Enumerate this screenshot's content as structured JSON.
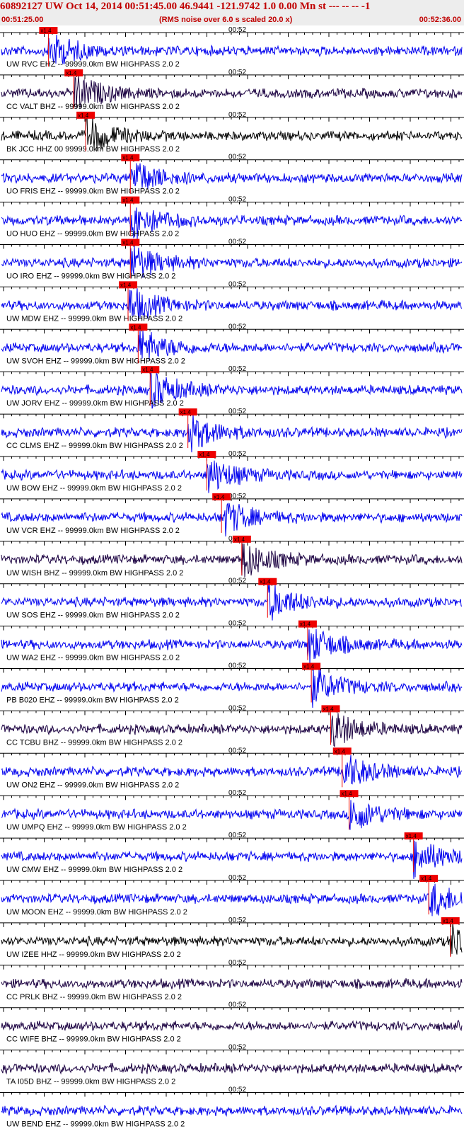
{
  "header": {
    "title": "60892127 UW Oct 14, 2014 00:51:45.00   46.9441 -121.9742  1.0 0.00 Mn st --- -- -- -1",
    "start_time": "00:51:25.00",
    "end_time": "00:52:36.00",
    "note": "(RMS noise over 6.0 s scaled 20.0 x)"
  },
  "chart_data": {
    "type": "line",
    "title": "60892127 UW Oct 14, 2014 00:51:45.00   46.9441 -121.9742  1.0 0.00 Mn st --- -- -- -1",
    "x_range": [
      "00:51:25.00",
      "00:52:36.00"
    ],
    "x_tick_label": "00:52",
    "pick_label": "x1.4",
    "colors": {
      "trace_blue": "#0000ee",
      "trace_dark": "#1a0040",
      "trace_black": "#000000",
      "pick": "#ee0000",
      "header_text": "#c00000"
    },
    "series": [
      {
        "name": "UW RVC EHZ -- 99999.0km BW  HIGHPASS  2.0  2",
        "color": "#0000ee",
        "pick_frac": 0.102
      },
      {
        "name": "CC VALT BHZ -- 99999.0km BW  HIGHPASS  2.0  2",
        "color": "#1a0040",
        "pick_frac": 0.157
      },
      {
        "name": "BK JCC HHZ 00 99999.0km BW  HIGHPASS  2.0  2",
        "color": "#000000",
        "pick_frac": 0.183
      },
      {
        "name": "UO FRIS EHZ -- 99999.0km BW  HIGHPASS  2.0  2",
        "color": "#0000ee",
        "pick_frac": 0.28
      },
      {
        "name": "UO HUO EHZ -- 99999.0km BW  HIGHPASS  2.0  2",
        "color": "#0000ee",
        "pick_frac": 0.28
      },
      {
        "name": "UO IRO EHZ -- 99999.0km BW  HIGHPASS  2.0  2",
        "color": "#0000ee",
        "pick_frac": 0.28
      },
      {
        "name": "UW MDW EHZ -- 99999.0km BW  HIGHPASS  2.0  2",
        "color": "#0000ee",
        "pick_frac": 0.275
      },
      {
        "name": "UW SVOH EHZ -- 99999.0km BW  HIGHPASS  2.0  2",
        "color": "#0000ee",
        "pick_frac": 0.297
      },
      {
        "name": "UW JORV EHZ -- 99999.0km BW  HIGHPASS  2.0  2",
        "color": "#0000ee",
        "pick_frac": 0.323
      },
      {
        "name": "CC CLMS EHZ -- 99999.0km BW  HIGHPASS  2.0  2",
        "color": "#0000ee",
        "pick_frac": 0.405
      },
      {
        "name": "UW BOW EHZ -- 99999.0km BW  HIGHPASS  2.0  2",
        "color": "#0000ee",
        "pick_frac": 0.446
      },
      {
        "name": "UW VCR EHZ -- 99999.0km BW  HIGHPASS  2.0  2",
        "color": "#0000ee",
        "pick_frac": 0.478
      },
      {
        "name": "UW WISH BHZ -- 99999.0km BW  HIGHPASS  2.0  2",
        "color": "#1a0040",
        "pick_frac": 0.522
      },
      {
        "name": "UW SOS EHZ -- 99999.0km BW  HIGHPASS  2.0  2",
        "color": "#0000ee",
        "pick_frac": 0.578
      },
      {
        "name": "UW WA2 EHZ -- 99999.0km BW  HIGHPASS  2.0  2",
        "color": "#0000ee",
        "pick_frac": 0.665
      },
      {
        "name": "PB B020 EHZ -- 99999.0km BW  HIGHPASS  2.0  2",
        "color": "#0000ee",
        "pick_frac": 0.673
      },
      {
        "name": "CC TCBU BHZ -- 99999.0km BW  HIGHPASS  2.0  2",
        "color": "#1a0040",
        "pick_frac": 0.715
      },
      {
        "name": "UW ON2 EHZ -- 99999.0km BW  HIGHPASS  2.0  2",
        "color": "#0000ee",
        "pick_frac": 0.74
      },
      {
        "name": "UW UMPQ EHZ -- 99999.0km BW  HIGHPASS  2.0  2",
        "color": "#0000ee",
        "pick_frac": 0.755
      },
      {
        "name": "UW CMW EHZ -- 99999.0km BW  HIGHPASS  2.0  2",
        "color": "#0000ee",
        "pick_frac": 0.895
      },
      {
        "name": "UW MOON EHZ -- 99999.0km BW  HIGHPASS  2.0  2",
        "color": "#0000ee",
        "pick_frac": 0.928
      },
      {
        "name": "UW IZEE HHZ -- 99999.0km BW  HIGHPASS  2.0  2",
        "color": "#000000",
        "pick_frac": 0.975
      },
      {
        "name": "CC PRLK BHZ -- 99999.0km BW  HIGHPASS  2.0  2",
        "color": "#1a0040",
        "pick_frac": null
      },
      {
        "name": "CC WIFE BHZ -- 99999.0km BW  HIGHPASS  2.0  2",
        "color": "#1a0040",
        "pick_frac": null
      },
      {
        "name": "TA I05D BHZ -- 99999.0km BW  HIGHPASS  2.0  2",
        "color": "#1a0040",
        "pick_frac": null
      },
      {
        "name": "UW BEND EHZ -- 99999.0km BW  HIGHPASS  2.0  2",
        "color": "#0000ee",
        "pick_frac": null
      }
    ]
  }
}
